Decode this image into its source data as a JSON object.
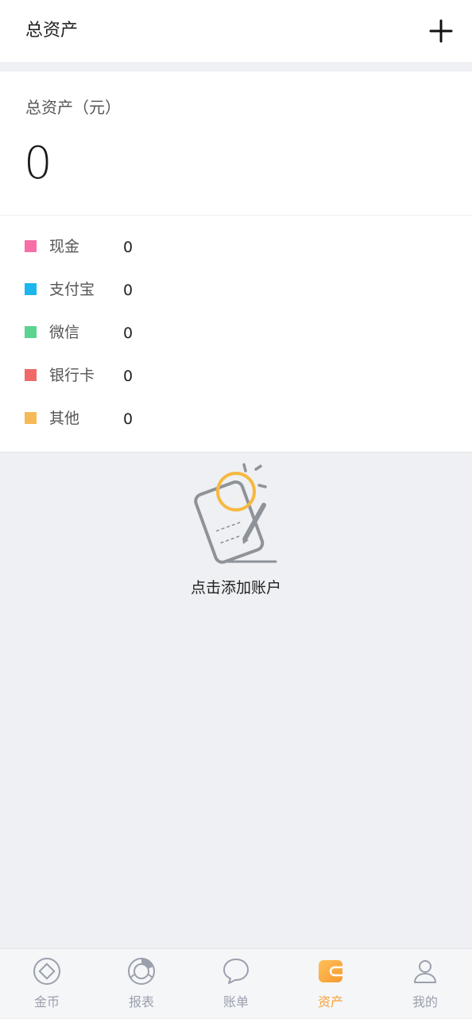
{
  "header": {
    "title": "总资产",
    "add_icon": "plus-icon"
  },
  "summary": {
    "label": "总资产（元）",
    "value": "0"
  },
  "breakdown": [
    {
      "label": "现金",
      "value": "0",
      "color": "#f76fa6"
    },
    {
      "label": "支付宝",
      "value": "0",
      "color": "#1bb6ee"
    },
    {
      "label": "微信",
      "value": "0",
      "color": "#5ad48f"
    },
    {
      "label": "银行卡",
      "value": "0",
      "color": "#f06868"
    },
    {
      "label": "其他",
      "value": "0",
      "color": "#f6b957"
    }
  ],
  "empty_state": {
    "icon": "notebook-pen-icon",
    "text": "点击添加账户"
  },
  "tabs": [
    {
      "label": "金币",
      "icon": "coin-icon",
      "active": false
    },
    {
      "label": "报表",
      "icon": "pie-chart-icon",
      "active": false
    },
    {
      "label": "账单",
      "icon": "chat-bubble-icon",
      "active": false
    },
    {
      "label": "资产",
      "icon": "wallet-icon",
      "active": true
    },
    {
      "label": "我的",
      "icon": "user-icon",
      "active": false
    }
  ],
  "colors": {
    "accent": "#f5a33a",
    "inactive_tab": "#9aa0ad",
    "background": "#eef0f3"
  }
}
